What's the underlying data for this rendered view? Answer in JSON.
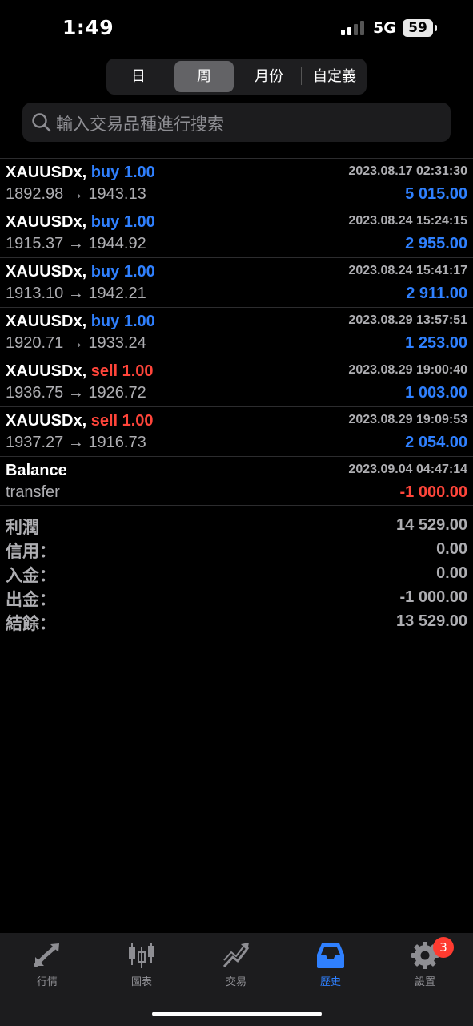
{
  "status_bar": {
    "time": "1:49",
    "network": "5G",
    "battery": "59"
  },
  "period_tabs": [
    {
      "label": "日",
      "active": false
    },
    {
      "label": "周",
      "active": true
    },
    {
      "label": "月份",
      "active": false
    },
    {
      "label": "自定義",
      "active": false
    }
  ],
  "search": {
    "placeholder": "輸入交易品種進行搜索"
  },
  "deals": [
    {
      "symbol": "XAUUSDx,",
      "side": "buy 1.00",
      "side_type": "buy",
      "datetime": "2023.08.17 02:31:30",
      "prices": "1892.98 → 1943.13",
      "profit": "5 015.00"
    },
    {
      "symbol": "XAUUSDx,",
      "side": "buy 1.00",
      "side_type": "buy",
      "datetime": "2023.08.24 15:24:15",
      "prices": "1915.37 → 1944.92",
      "profit": "2 955.00"
    },
    {
      "symbol": "XAUUSDx,",
      "side": "buy 1.00",
      "side_type": "buy",
      "datetime": "2023.08.24 15:41:17",
      "prices": "1913.10 → 1942.21",
      "profit": "2 911.00"
    },
    {
      "symbol": "XAUUSDx,",
      "side": "buy 1.00",
      "side_type": "buy",
      "datetime": "2023.08.29 13:57:51",
      "prices": "1920.71 → 1933.24",
      "profit": "1 253.00"
    },
    {
      "symbol": "XAUUSDx,",
      "side": "sell 1.00",
      "side_type": "sell",
      "datetime": "2023.08.29 19:00:40",
      "prices": "1936.75 → 1926.72",
      "profit": "1 003.00"
    },
    {
      "symbol": "XAUUSDx,",
      "side": "sell 1.00",
      "side_type": "sell",
      "datetime": "2023.08.29 19:09:53",
      "prices": "1937.27 → 1916.73",
      "profit": "2 054.00"
    }
  ],
  "balance_row": {
    "title": "Balance",
    "datetime": "2023.09.04 04:47:14",
    "comment": "transfer",
    "amount": "-1 000.00"
  },
  "summary": [
    {
      "label": "利潤",
      "value": "14 529.00"
    },
    {
      "label": "信用：",
      "value": "0.00"
    },
    {
      "label": "入金：",
      "value": "0.00"
    },
    {
      "label": "出金：",
      "value": "-1 000.00"
    },
    {
      "label": "結餘：",
      "value": "13 529.00"
    }
  ],
  "tab_bar": [
    {
      "label": "行情",
      "icon": "quotes-arrows-icon",
      "active": false
    },
    {
      "label": "圖表",
      "icon": "candlestick-chart-icon",
      "active": false
    },
    {
      "label": "交易",
      "icon": "trade-trend-icon",
      "active": false
    },
    {
      "label": "歷史",
      "icon": "history-inbox-icon",
      "active": true
    },
    {
      "label": "設置",
      "icon": "gear-icon",
      "active": false
    }
  ],
  "settings_badge": "3",
  "colors": {
    "accent": "#2f80ff",
    "negative": "#ff453a",
    "muted": "#aeaeb2",
    "background": "#000000"
  }
}
